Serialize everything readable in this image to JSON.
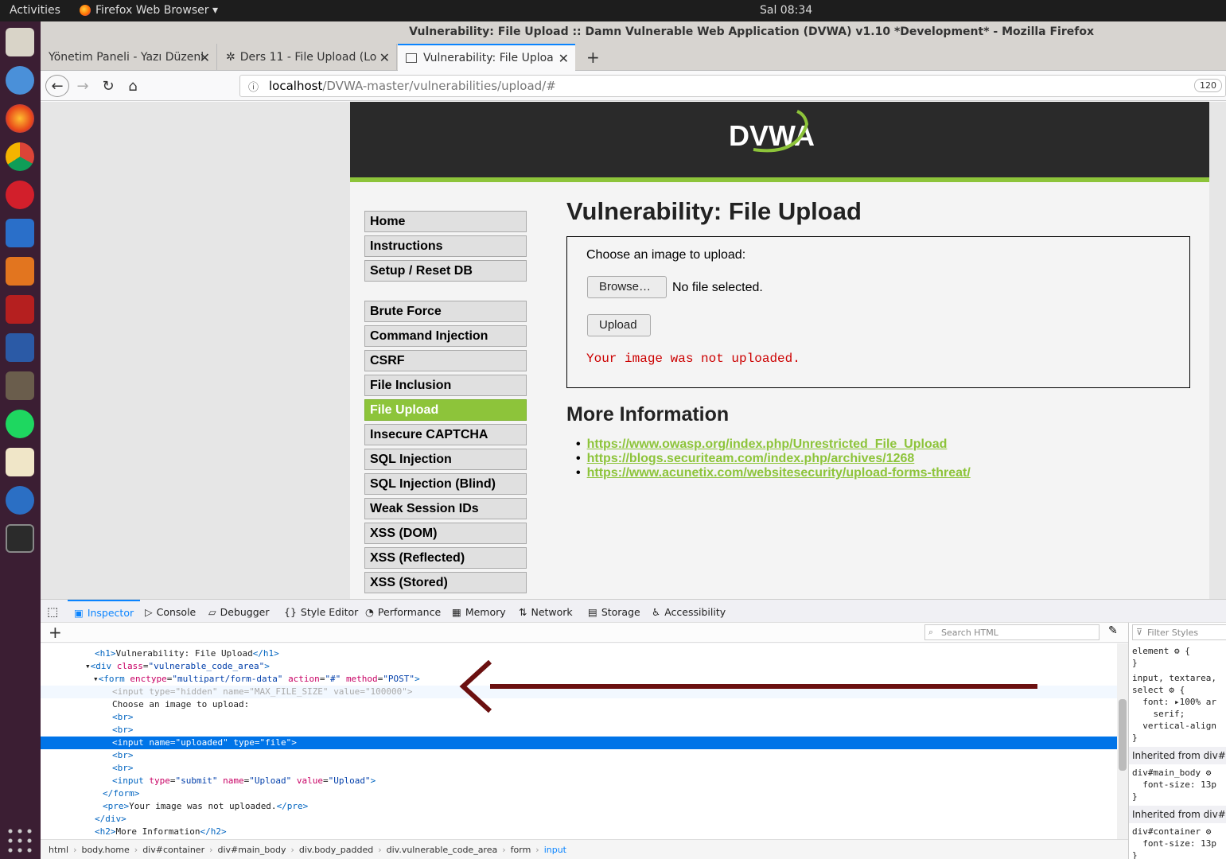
{
  "topbar": {
    "activities": "Activities",
    "app": "Firefox Web Browser ▾",
    "clock": "Sal 08:34"
  },
  "window": {
    "title": "Vulnerability: File Upload :: Damn Vulnerable Web Application (DVWA) v1.10 *Development* - Mozilla Firefox"
  },
  "tabs": [
    {
      "label": "Yönetim Paneli - Yazı Düzenl"
    },
    {
      "label": "Ders 11 - File Upload (Lo"
    },
    {
      "label": "Vulnerability: File Uploa"
    }
  ],
  "nav": {
    "url_host": "localhost",
    "url_path": "/DVWA-master/vulnerabilities/upload/#",
    "zoom": "120"
  },
  "dvwa": {
    "logo": "DVWA",
    "menu": [
      "Home",
      "Instructions",
      "Setup / Reset DB",
      "Brute Force",
      "Command Injection",
      "CSRF",
      "File Inclusion",
      "File Upload",
      "Insecure CAPTCHA",
      "SQL Injection",
      "SQL Injection (Blind)",
      "Weak Session IDs",
      "XSS (DOM)",
      "XSS (Reflected)",
      "XSS (Stored)"
    ],
    "title": "Vulnerability: File Upload",
    "choose_label": "Choose an image to upload:",
    "browse": "Browse…",
    "no_file": "No file selected.",
    "upload": "Upload",
    "error": "Your image was not uploaded.",
    "more_info": "More Information",
    "links": [
      "https://www.owasp.org/index.php/Unrestricted_File_Upload",
      "https://blogs.securiteam.com/index.php/archives/1268",
      "https://www.acunetix.com/websitesecurity/upload-forms-threat/"
    ]
  },
  "devtools": {
    "tabs": [
      "Inspector",
      "Console",
      "Debugger",
      "Style Editor",
      "Performance",
      "Memory",
      "Network",
      "Storage",
      "Accessibility"
    ],
    "search_placeholder": "Search HTML",
    "filter_placeholder": "Filter Styles",
    "breadcrumbs": [
      "html",
      "body.home",
      "div#container",
      "div#main_body",
      "div.body_padded",
      "div.vulnerable_code_area",
      "form",
      "input"
    ],
    "rules": {
      "r1": "element ⚙ {\n}",
      "r2": "input, textarea,\nselect ⚙ {\n  font: ▸100% ar\n    serif;\n  vertical-align\n}",
      "inh1": "Inherited from div#ma",
      "r3": "div#main_body ⚙\n  font-size: 13p\n}",
      "inh2": "Inherited from div#co",
      "r4": "div#container ⚙\n  font-size: 13p\n}"
    }
  }
}
